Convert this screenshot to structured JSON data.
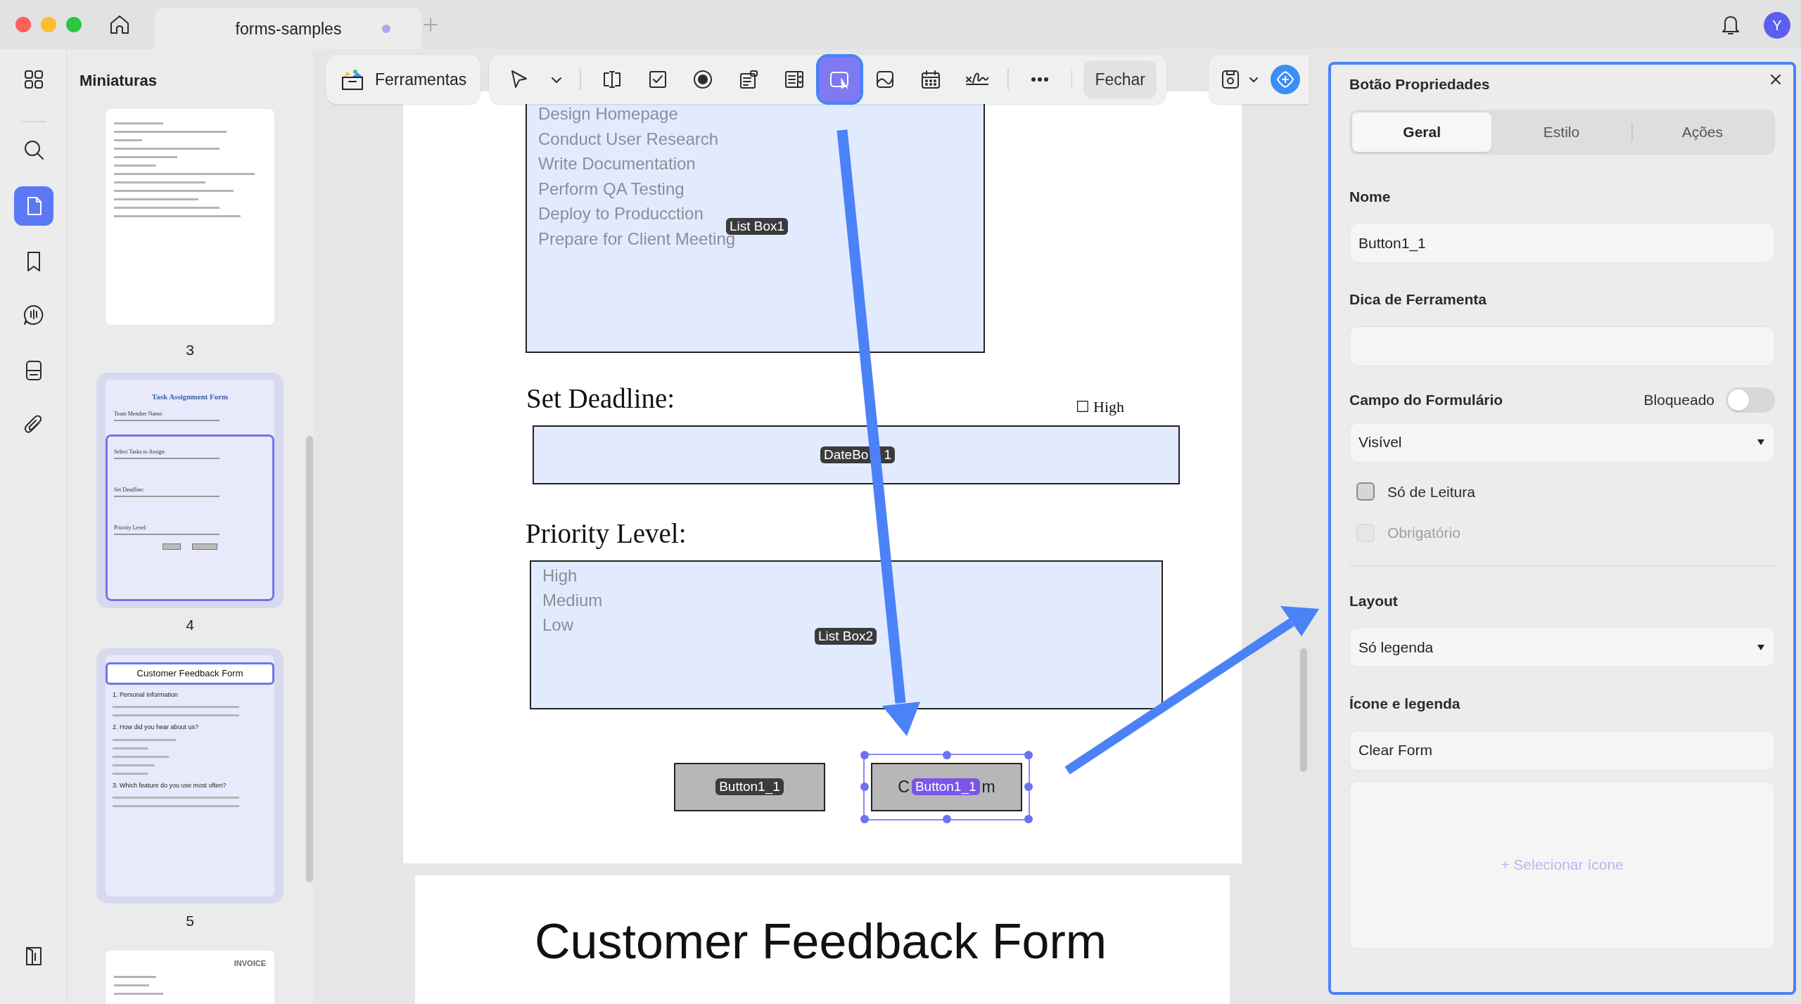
{
  "window": {
    "tab_title": "forms-samples",
    "tab_modified": true,
    "avatar_letter": "Y"
  },
  "rail": [
    {
      "kind": "grid",
      "selected": false
    },
    {
      "kind": "search",
      "selected": false
    },
    {
      "kind": "pages",
      "selected": true
    },
    {
      "kind": "bookmark",
      "selected": false
    },
    {
      "kind": "comment",
      "selected": false
    },
    {
      "kind": "stack",
      "selected": false
    },
    {
      "kind": "attachment",
      "selected": false
    },
    {
      "kind": "panel",
      "selected": false
    }
  ],
  "thumbnails": {
    "title": "Miniaturas",
    "pages": [
      {
        "kind": "application",
        "label": "3",
        "selected": false
      },
      {
        "kind": "task",
        "label": "4",
        "selected": true,
        "heading": "Task Assignment Form",
        "lines": [
          "Team Member Name:",
          "Select Tasks to Assign:",
          "Set Deadline:",
          "Priority Level:"
        ]
      },
      {
        "kind": "feedback",
        "label": "5",
        "selected": true,
        "heading": "Customer Feedback Form",
        "lines": [
          "1. Personal Information",
          "2. How did you hear about us?",
          "3. Which feature do you use most often?"
        ]
      },
      {
        "kind": "invoice",
        "selected": false,
        "heading": "INVOICE"
      }
    ]
  },
  "toolbar": {
    "tools_label": "Ferramentas",
    "tools": [
      {
        "kind": "pointer",
        "selected": false
      },
      {
        "kind": "chevron",
        "selected": false
      },
      {
        "kind": "sep"
      },
      {
        "kind": "textfield",
        "selected": false
      },
      {
        "kind": "checkbox",
        "selected": false
      },
      {
        "kind": "radio",
        "selected": false
      },
      {
        "kind": "combo",
        "selected": false
      },
      {
        "kind": "list",
        "selected": false
      },
      {
        "kind": "button",
        "selected": true
      },
      {
        "kind": "image",
        "selected": false
      },
      {
        "kind": "calendar",
        "selected": false
      },
      {
        "kind": "signature",
        "selected": false
      },
      {
        "kind": "sep"
      },
      {
        "kind": "more",
        "selected": false
      },
      {
        "kind": "sep"
      }
    ],
    "close_label": "Fechar"
  },
  "document": {
    "list_box_1": {
      "items": [
        "Design Homepage",
        "Conduct User Research",
        "Write Documentation",
        "Perform QA Testing",
        "Deploy to Producction",
        "Prepare for Client Meeting"
      ],
      "tag": "List Box1"
    },
    "deadline": {
      "label": "Set Deadline:",
      "option": "☐ High",
      "tag_parts": [
        "DateBo",
        "1"
      ]
    },
    "priority": {
      "label": "Priority Level:",
      "items": [
        "High",
        "Medium",
        "Low"
      ],
      "tag": "List Box2"
    },
    "buttons": [
      {
        "tag": "Button1_1",
        "selected": false
      },
      {
        "tag": "Button1_1",
        "caption_parts": [
          "C",
          "m"
        ],
        "selected": true
      }
    ],
    "next_page_heading": "Customer Feedback Form"
  },
  "panel": {
    "title": "Botão Propriedades",
    "tabs": [
      {
        "label": "Geral",
        "selected": true
      },
      {
        "label": "Estilo",
        "selected": false
      },
      {
        "label": "Ações",
        "selected": false
      }
    ],
    "name_label": "Nome",
    "name_value": "Button1_1",
    "tooltip_label": "Dica de Ferramenta",
    "form_field_label": "Campo do Formulário",
    "locked_label": "Bloqueado",
    "locked": false,
    "visibility": "Visível",
    "checks": [
      {
        "label": "Só de Leitura",
        "checked": false,
        "disabled": false
      },
      {
        "label": "Obrigatório",
        "checked": false,
        "disabled": true
      }
    ],
    "layout_label": "Layout",
    "layout_value": "Só legenda",
    "caption_label": "Ícone e legenda",
    "caption_value": "Clear Form",
    "select_icon": "+ Selecionar ícone"
  }
}
